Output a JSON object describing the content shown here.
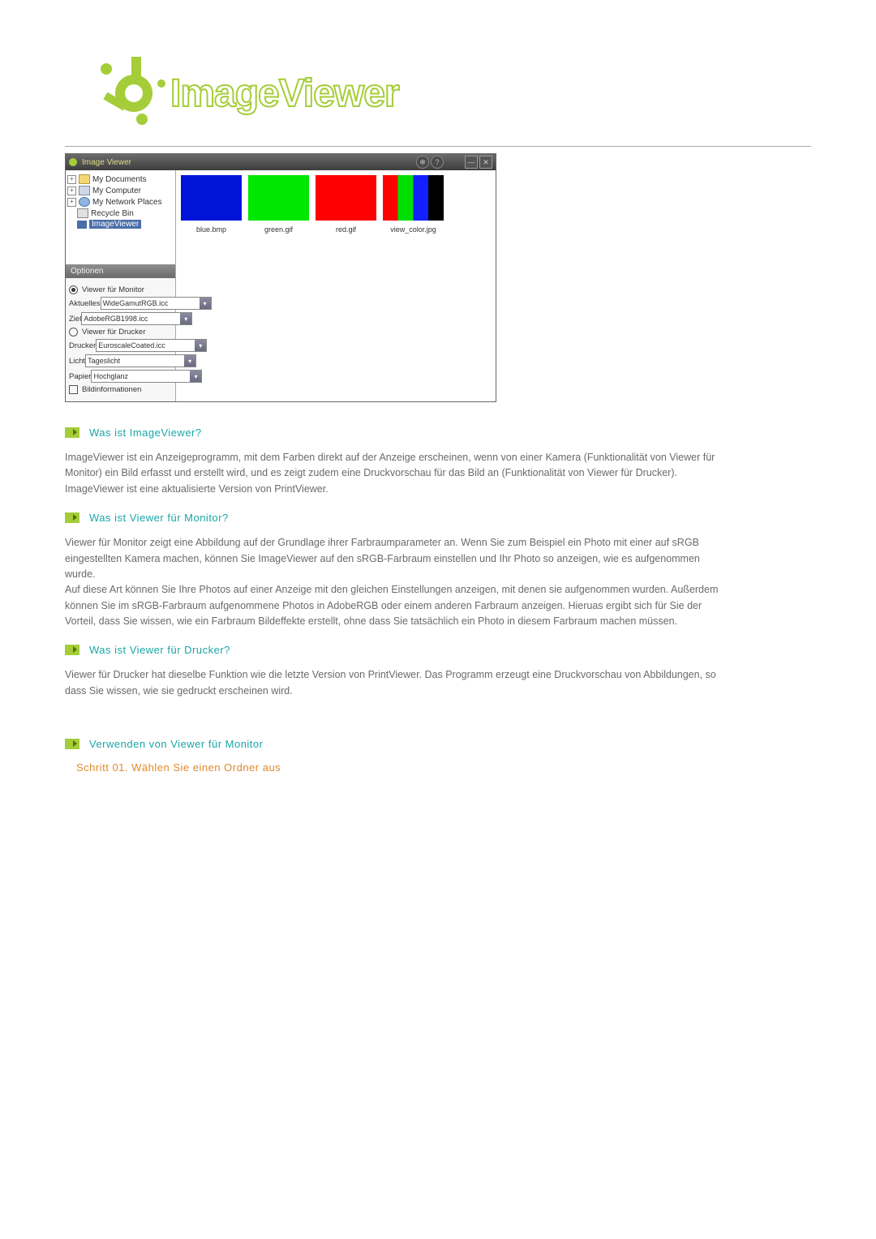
{
  "brand": "ImageViewer",
  "app": {
    "title": "Image Viewer",
    "tree": {
      "my_documents": "My Documents",
      "my_computer": "My Computer",
      "my_network": "My Network Places",
      "recycle_bin": "Recycle Bin",
      "selected": "ImageViewer"
    },
    "thumbs": {
      "blue": "blue.bmp",
      "green": "green.gif",
      "red": "red.gif",
      "stripes": "view_color.jpg"
    },
    "options": {
      "tab": "Optionen",
      "viewer_monitor": "Viewer für Monitor",
      "aktuelles_label": "Aktuelles",
      "aktuelles_value": "WideGamutRGB.icc",
      "ziel_label": "Ziel",
      "ziel_value": "AdobeRGB1998.icc",
      "viewer_drucker": "Viewer für Drucker",
      "drucker_label": "Drucker",
      "drucker_value": "EuroscaleCoated.icc",
      "licht_label": "Licht",
      "licht_value": "Tageslicht",
      "papier_label": "Papier",
      "papier_value": "Hochglanz",
      "bildinfo": "Bildinformationen"
    }
  },
  "sections": {
    "s1_title": "Was ist ImageViewer?",
    "s1_body": "ImageViewer ist ein Anzeigeprogramm, mit dem Farben direkt auf der Anzeige erscheinen, wenn von einer Kamera (Funktionalität von Viewer für Monitor) ein Bild erfasst und erstellt wird, und es zeigt zudem eine Druckvorschau für das Bild an (Funktionalität von Viewer für Drucker). ImageViewer ist eine aktualisierte Version von PrintViewer.",
    "s2_title": "Was ist Viewer für Monitor?",
    "s2_body_a": "Viewer für Monitor zeigt eine Abbildung auf der Grundlage ihrer Farbraumparameter an. Wenn Sie zum Beispiel ein Photo mit einer auf sRGB eingestellten Kamera machen, können Sie ImageViewer auf den sRGB-Farbraum einstellen und Ihr Photo so anzeigen, wie es aufgenommen wurde.",
    "s2_body_b": "Auf diese Art können Sie Ihre Photos auf einer Anzeige mit den gleichen Einstellungen anzeigen, mit denen sie aufgenommen wurden. Außerdem können Sie im sRGB-Farbraum aufgenommene Photos in AdobeRGB oder einem anderen Farbraum anzeigen. Hieruas ergibt sich für Sie der Vorteil, dass Sie wissen, wie ein Farbraum Bildeffekte erstellt, ohne dass Sie tatsächlich ein Photo in diesem Farbraum machen müssen.",
    "s3_title": "Was ist Viewer für Drucker?",
    "s3_body": "Viewer für Drucker hat dieselbe Funktion wie die letzte Version von PrintViewer. Das Programm erzeugt eine Druckvorschau von Abbildungen, so dass Sie wissen, wie sie gedruckt erscheinen wird.",
    "s4_title": "Verwenden von Viewer für Monitor",
    "step1": "Schritt 01. Wählen Sie einen Ordner aus"
  }
}
